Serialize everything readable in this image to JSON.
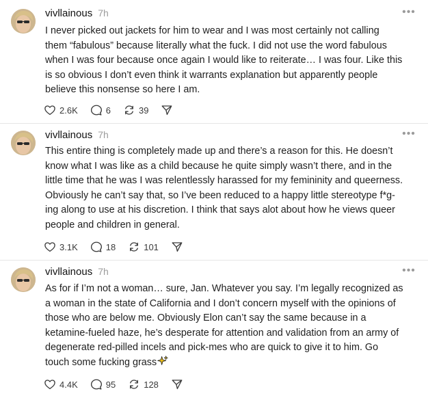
{
  "posts": [
    {
      "username": "vivllainous",
      "timestamp": "7h",
      "more_icon": "more-horizontal-icon",
      "lines": [
        "I never picked out jackets for him to wear and I was most certainly not calling",
        "them “fabulous” because literally what the fuck. I did not use the word fabulous",
        "when I was four because once again I would like to reiterate… I was four. Like this",
        "is so obvious I don’t even think it warrants explanation but apparently people",
        "believe this nonsense so here I am."
      ],
      "likes": "2.6K",
      "replies": "6",
      "reposts": "39"
    },
    {
      "username": "vivllainous",
      "timestamp": "7h",
      "more_icon": "more-horizontal-icon",
      "lines": [
        "This entire thing is completely made up and there’s a reason for this. He doesn’t",
        "know what I was like as a child because he quite simply wasn’t there, and in the",
        "little time that he was I was relentlessly harassed for my femininity and queerness.",
        "Obviously he can’t say that, so I’ve been reduced to a happy little stereotype f*g-",
        "ing along to use at his discretion. I think that says alot about how he views queer",
        "people and children in general."
      ],
      "likes": "3.1K",
      "replies": "18",
      "reposts": "101"
    },
    {
      "username": "vivllainous",
      "timestamp": "7h",
      "more_icon": "more-horizontal-icon",
      "lines": [
        "As for if I’m not a woman… sure, Jan. Whatever you say. I’m legally recognized as",
        "a woman in the state of California and I don’t concern myself with the opinions of",
        "those who are below me. Obviously Elon can’t say the same because in a",
        "ketamine-fueled haze, he’s desperate for attention and validation from an army of",
        "degenerate red-pilled incels and pick-mes who are quick to give it to him. Go",
        "touch some fucking grass"
      ],
      "trailing_emoji_icon": "sparkles-icon",
      "likes": "4.4K",
      "replies": "95",
      "reposts": "128"
    }
  ],
  "colors": {
    "text": "#1f1f1f",
    "muted": "#9b9b9b",
    "divider": "#e6e6e6",
    "sparkle": "#f5c518"
  }
}
